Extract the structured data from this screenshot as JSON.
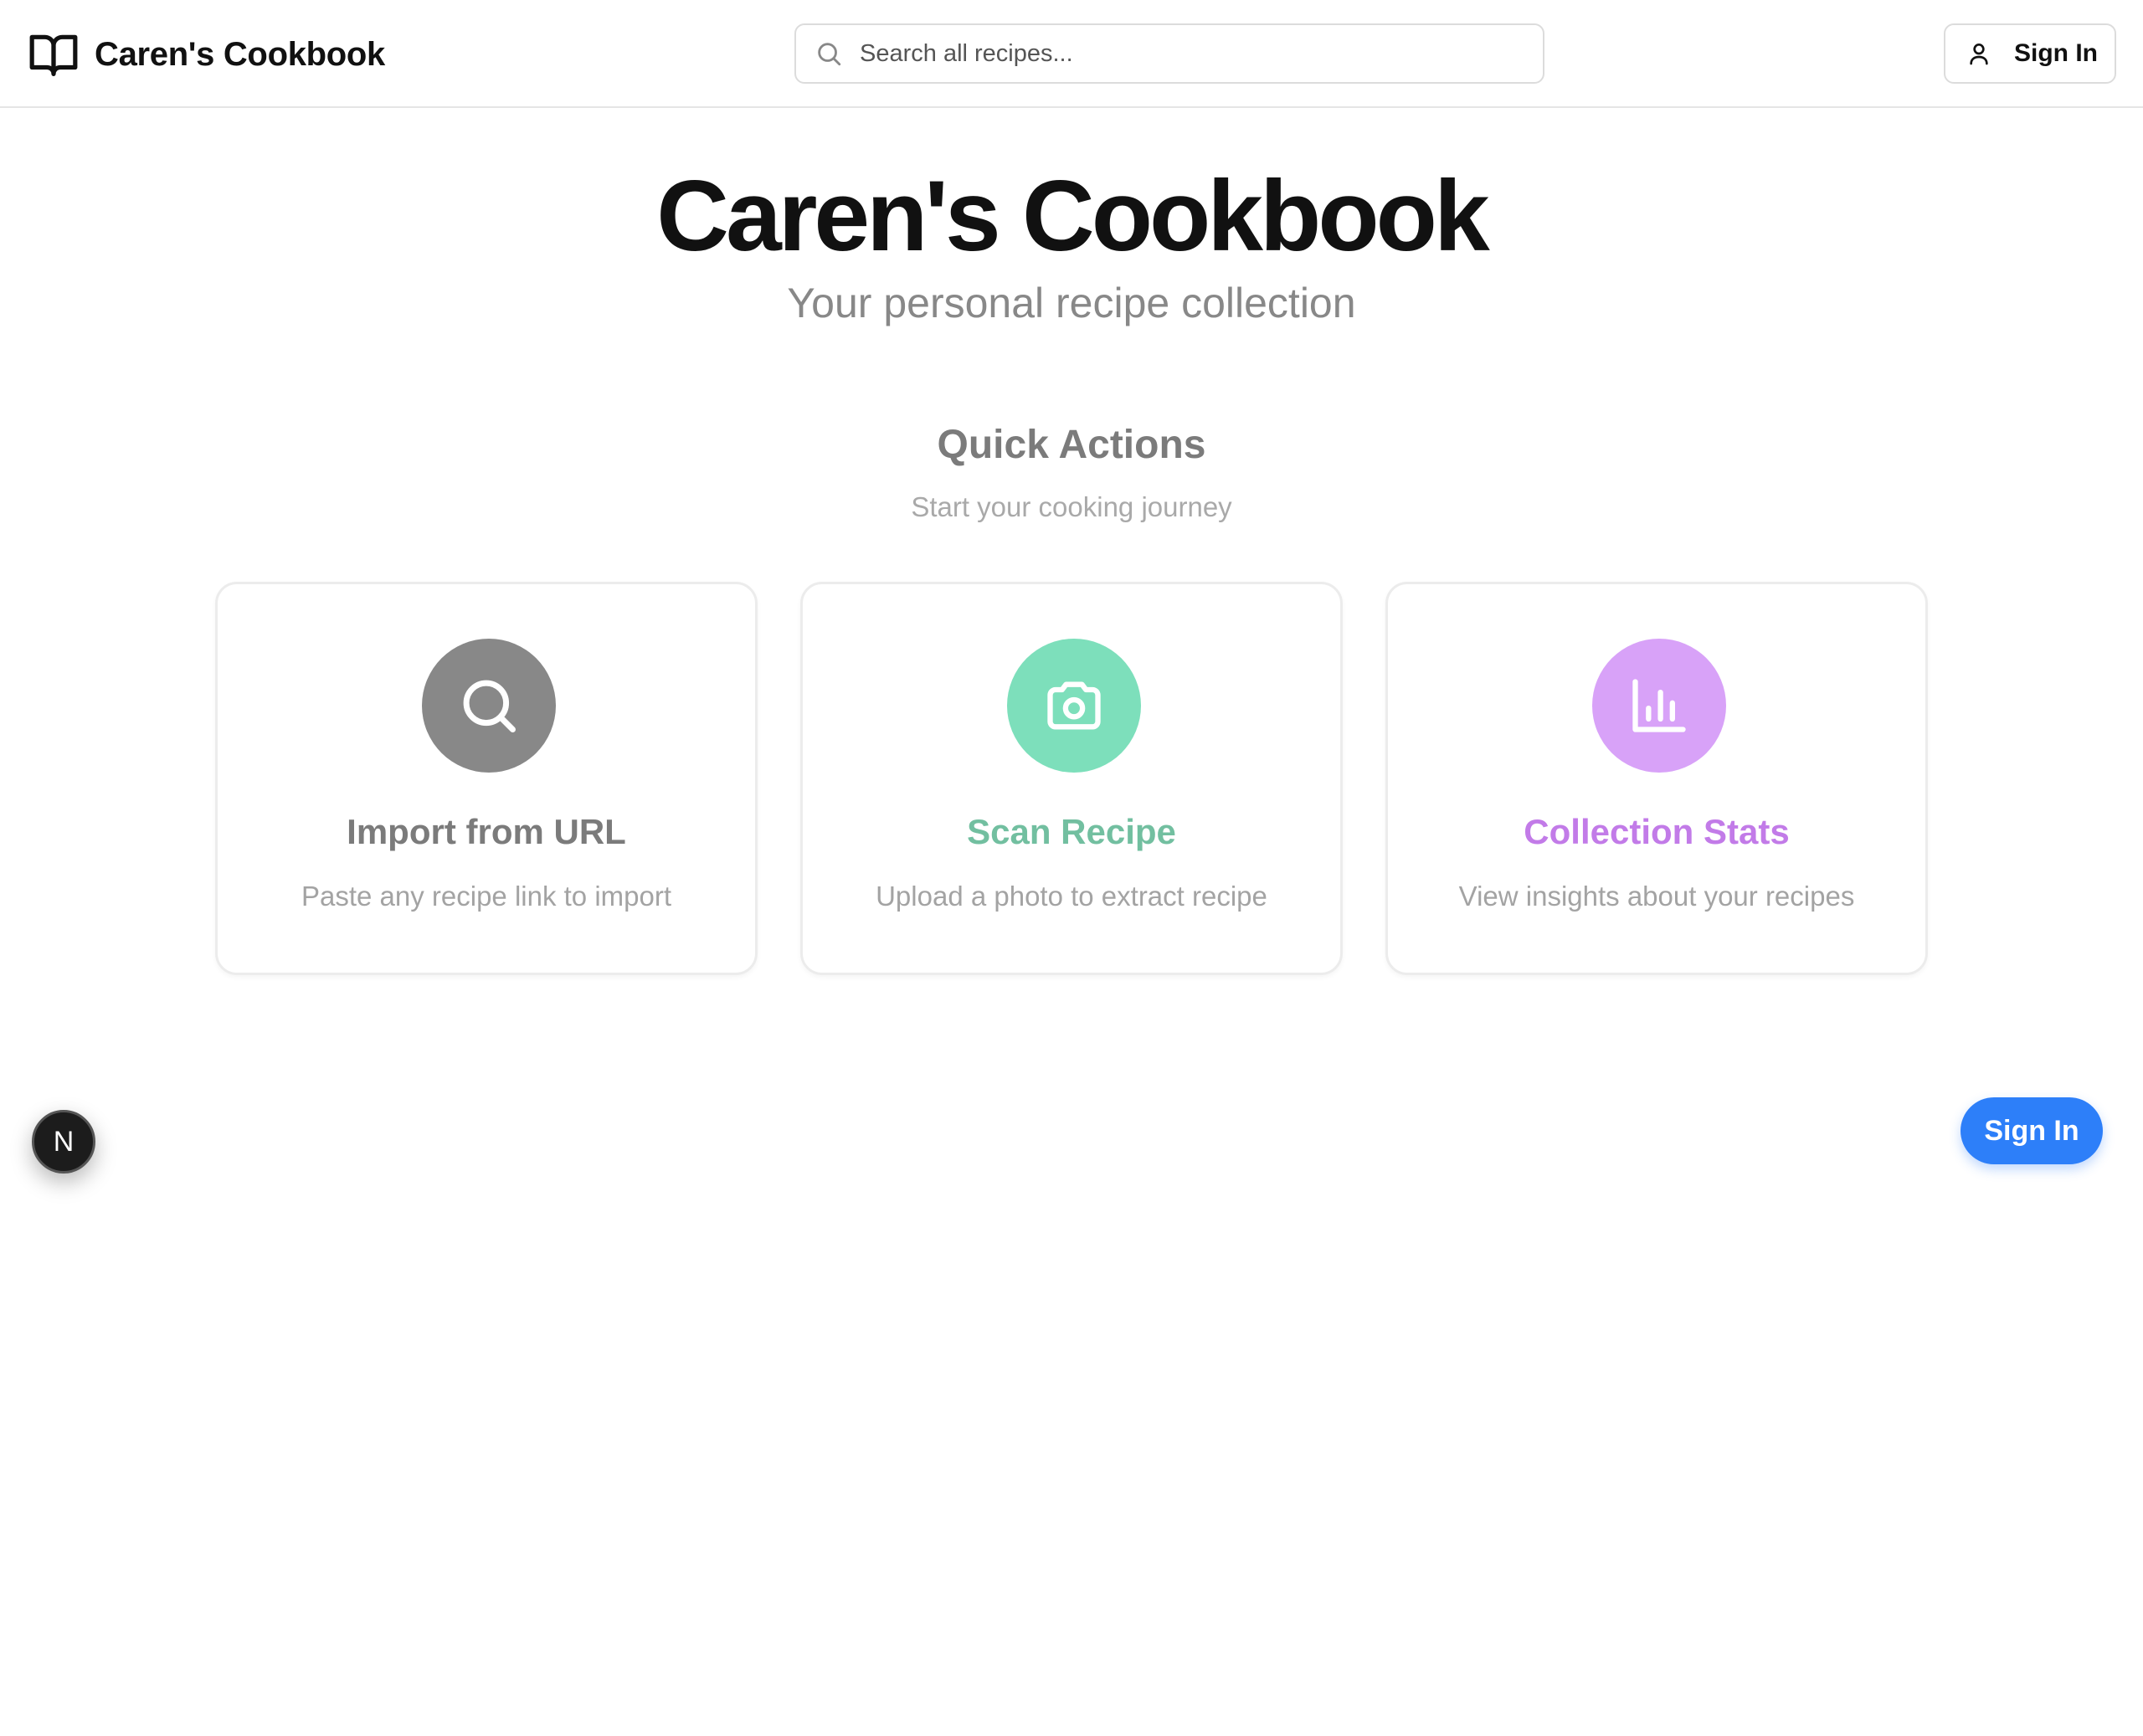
{
  "header": {
    "brand_name": "Caren's Cookbook",
    "search_placeholder": "Search all recipes...",
    "signin_label": "Sign In"
  },
  "hero": {
    "title": "Caren's Cookbook",
    "subtitle": "Your personal recipe collection"
  },
  "quick_actions": {
    "title": "Quick Actions",
    "subtitle": "Start your cooking journey",
    "cards": [
      {
        "title": "Import from URL",
        "description": "Paste any recipe link to import",
        "icon": "search-icon",
        "accent_color": "#888888",
        "title_color": "#7b7b7b"
      },
      {
        "title": "Scan Recipe",
        "description": "Upload a photo to extract recipe",
        "icon": "camera-icon",
        "accent_color": "#7ddfbb",
        "title_color": "#72bfa0"
      },
      {
        "title": "Collection Stats",
        "description": "View insights about your recipes",
        "icon": "bar-chart-icon",
        "accent_color": "#d8a2f8",
        "title_color": "#c27be8"
      }
    ]
  },
  "floating": {
    "dev_badge_letter": "N",
    "signin_label": "Sign In",
    "signin_color": "#2d7ff9"
  }
}
